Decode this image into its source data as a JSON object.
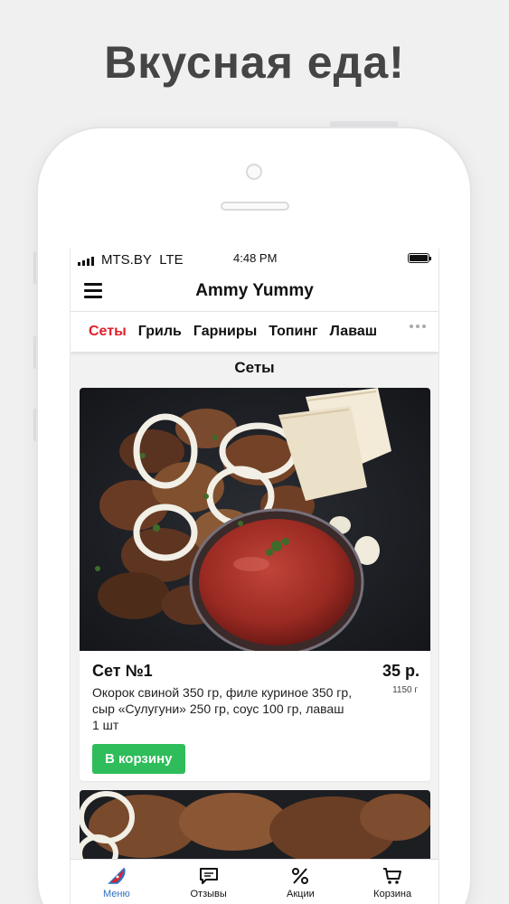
{
  "headline": "Вкусная еда!",
  "status_bar": {
    "carrier": "MTS.BY",
    "network": "LTE",
    "time": "4:48 PM"
  },
  "app": {
    "title": "Ammy Yummy"
  },
  "tabs": [
    {
      "label": "Сеты",
      "active": true
    },
    {
      "label": "Гриль",
      "active": false
    },
    {
      "label": "Гарниры",
      "active": false
    },
    {
      "label": "Топинг",
      "active": false
    },
    {
      "label": "Лаваш",
      "active": false
    }
  ],
  "section_title": "Сеты",
  "products": [
    {
      "name": "Сет №1",
      "price": "35 р.",
      "weight": "1150 г",
      "description": "Окорок свиной 350 гр, филе куриное 350 гр, сыр «Сулугуни» 250 гр, соус 100 гр, лаваш 1 шт",
      "button_label": "В корзину",
      "image_icon": "grilled-meat-set-photo"
    }
  ],
  "bottom_nav": [
    {
      "label": "Меню",
      "icon": "pizza-slice-icon",
      "active": true
    },
    {
      "label": "Отзывы",
      "icon": "chat-bubble-icon",
      "active": false
    },
    {
      "label": "Акции",
      "icon": "percent-icon",
      "active": false
    },
    {
      "label": "Корзина",
      "icon": "cart-icon",
      "active": false
    }
  ],
  "colors": {
    "accent_red": "#e0202c",
    "button_green": "#2ebd5a",
    "nav_active_blue": "#2f6fbf",
    "headline_gray": "#454545"
  }
}
